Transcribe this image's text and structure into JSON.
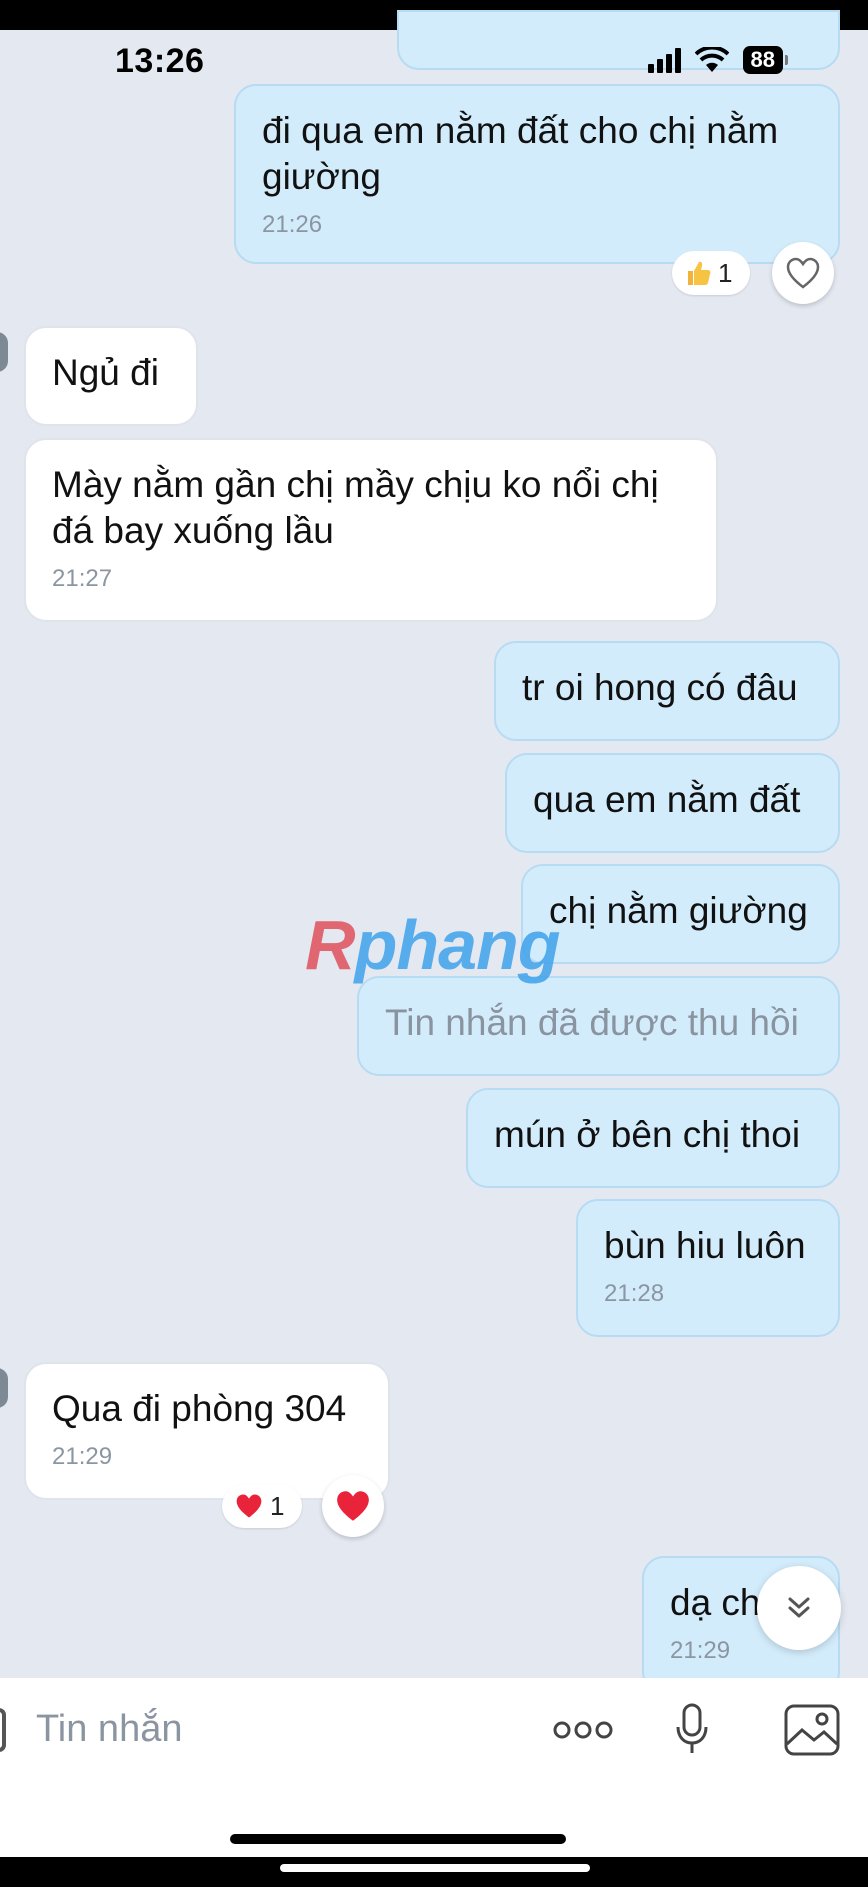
{
  "status_bar": {
    "time": "13:26",
    "battery": "88"
  },
  "messages": [
    {
      "id": "m1",
      "text": "đi qua em nằm đất cho chị nằm giường",
      "time": "21:26"
    },
    {
      "id": "m2",
      "text": "Ngủ đi"
    },
    {
      "id": "m3",
      "text": "Mày nằm gần chị mầy chịu ko nổi chị đá bay xuống lầu",
      "time": "21:27"
    },
    {
      "id": "m4",
      "text": "tr oi hong có đâu"
    },
    {
      "id": "m5",
      "text": "qua em nằm đất"
    },
    {
      "id": "m6",
      "text": "chị nằm giường"
    },
    {
      "id": "m7",
      "text": "Tin nhắn đã được thu hồi"
    },
    {
      "id": "m8",
      "text": "mún ở bên chị thoi"
    },
    {
      "id": "m9",
      "text": "bùn hiu luôn",
      "time": "21:28"
    },
    {
      "id": "m10",
      "text": "Qua đi phòng 304",
      "time": "21:29"
    },
    {
      "id": "m11",
      "text": "dạ ch",
      "time": "21:29"
    }
  ],
  "reactions": {
    "m1": {
      "icon": "thumbs-up-icon",
      "count": "1"
    },
    "m10": {
      "icon": "heart-icon",
      "count": "1"
    }
  },
  "watermark": {
    "first": "R",
    "rest": "phang"
  },
  "composer": {
    "placeholder": "Tin nhắn"
  },
  "colors": {
    "outgoing": "#d3ecfb",
    "incoming": "#ffffff",
    "background": "#e4e8f1",
    "heart": "#e8233a"
  }
}
